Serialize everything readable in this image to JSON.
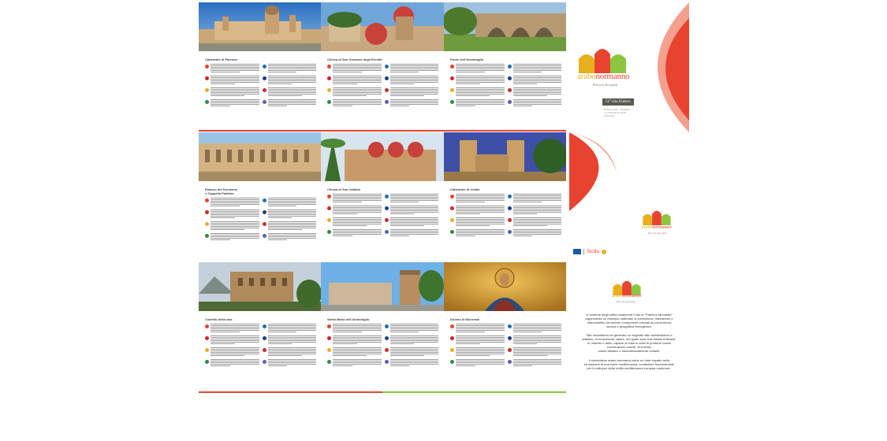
{
  "brochure": {
    "rows": [
      {
        "panels": [
          {
            "title": "Cattedrale di Palermo",
            "photo_icon": "cathedral-photo"
          },
          {
            "title": "Chiesa di San Giovanni degli Eremiti",
            "photo_icon": "red-domes-photo"
          },
          {
            "title": "Ponte dell'Ammiraglio",
            "photo_icon": "bridge-photo"
          }
        ],
        "divider_color": "#e8432f"
      },
      {
        "panels": [
          {
            "title": "Palazzo dei Normanni\ne Cappella Palatina",
            "photo_icon": "palace-photo"
          },
          {
            "title": "Chiesa di San Cataldo",
            "photo_icon": "san-cataldo-photo"
          },
          {
            "title": "Cattedrale di Cefalù",
            "photo_icon": "cefalu-photo"
          }
        ],
        "divider_color": "#ffffff"
      },
      {
        "panels": [
          {
            "title": "Castello della zisa",
            "photo_icon": "zisa-castle-photo"
          },
          {
            "title": "Santa Maria dell'Ammiraglio",
            "photo_icon": "martorana-photo"
          },
          {
            "title": "Duomo di Monreale",
            "photo_icon": "mosaic-photo"
          }
        ],
        "divider_color": "#e8432f"
      }
    ],
    "flag_colors": [
      "#e8432f",
      "#1d6fb8",
      "#d3212d",
      "#1b3d8f",
      "#e6b01e",
      "#cf2a2a",
      "#2e8b3e",
      "#5a5fb0"
    ]
  },
  "cover": {
    "brand_prefix": "arabo",
    "brand_suffix": "normanno",
    "tagline": "Percorso dei popoli",
    "unesco_badge": "51° sito Unesco",
    "unesco_sub": "Palermo Arabo - Normanno\ne le cattedrali di Cefalù\ne Monreale",
    "accent_color": "#e8432f",
    "logo_colors": [
      "#e6b01e",
      "#e8432f",
      "#8cc63f"
    ]
  },
  "back": {
    "brand_prefix": "arabo",
    "brand_suffix": "normanno",
    "tagline": "Percorso dei popoli",
    "region_label": "Sicilia",
    "unesco_label": "UNESCO"
  },
  "intro": {
    "brand_prefix": "arabo",
    "brand_suffix": "normanno",
    "tagline": "Percorso dei popoli",
    "paragraph_1": [
      "«L'insieme degli edifici costituenti il sito di \"Palermo Monreale\"",
      "rappresenta un esempio materiale di convivenza, interazione e",
      "interscambio tra diverse componenti culturali di provenienza",
      "storica e geografica eterogenea."
    ],
    "paragraph_2": [
      "Tale sincretismo ha generato un originale stile architettonico e",
      "artistico, di eccezionale valore, nel quale sono fusi elementi bizanti-",
      "ni, islamici e latini, capace di volta in volta di produrre nuove",
      "combinazioni uniche, di eccelso",
      "valore artistico e straordinariamente unitarie."
    ],
    "paragraph_3": [
      "Il sincretismo arabo-normanno ebbe un forte impatto nella",
      "formazione di una koinè mediterranea, condizione fondamentale",
      "per lo sviluppo della civiltà mediterranea europea moderna»."
    ]
  }
}
